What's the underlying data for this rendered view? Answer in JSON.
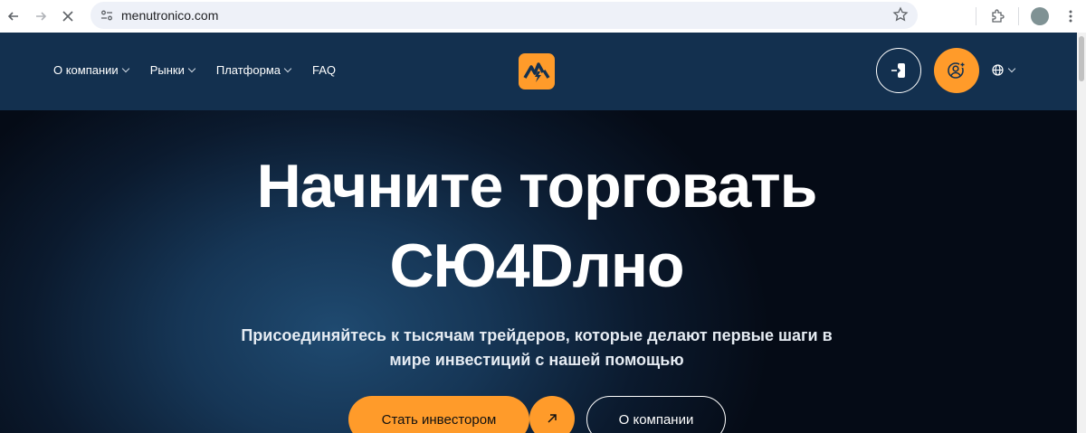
{
  "browser": {
    "url": "menutronico.com",
    "icons": [
      "back-icon",
      "forward-icon",
      "stop-icon",
      "site-info-icon",
      "bookmark-star-icon",
      "extensions-icon",
      "profile-avatar",
      "more-icon"
    ]
  },
  "header": {
    "menu": [
      {
        "label": "О компании",
        "has_dropdown": true
      },
      {
        "label": "Рынки",
        "has_dropdown": true
      },
      {
        "label": "Платформа",
        "has_dropdown": true
      },
      {
        "label": "FAQ",
        "has_dropdown": false
      }
    ],
    "logo_icon": "brand-logo-icon",
    "login_icon": "login-icon",
    "register_icon": "user-add-icon",
    "lang_icon": "globe-icon"
  },
  "hero": {
    "title_line1": "Начните торговать",
    "title_line2": "СЮ4Dлно",
    "subtitle_line1": "Присоединяйтесь к тысячам трейдеров, которые делают первые шаги в",
    "subtitle_line2": "мире инвестиций с нашей помощью",
    "cta_label": "Стать инвестором",
    "about_label": "О компании"
  },
  "colors": {
    "accent": "#ff9b2a",
    "header_bg": "#13304f",
    "hero_bg": "#0b1a2e",
    "text": "#ffffff"
  }
}
